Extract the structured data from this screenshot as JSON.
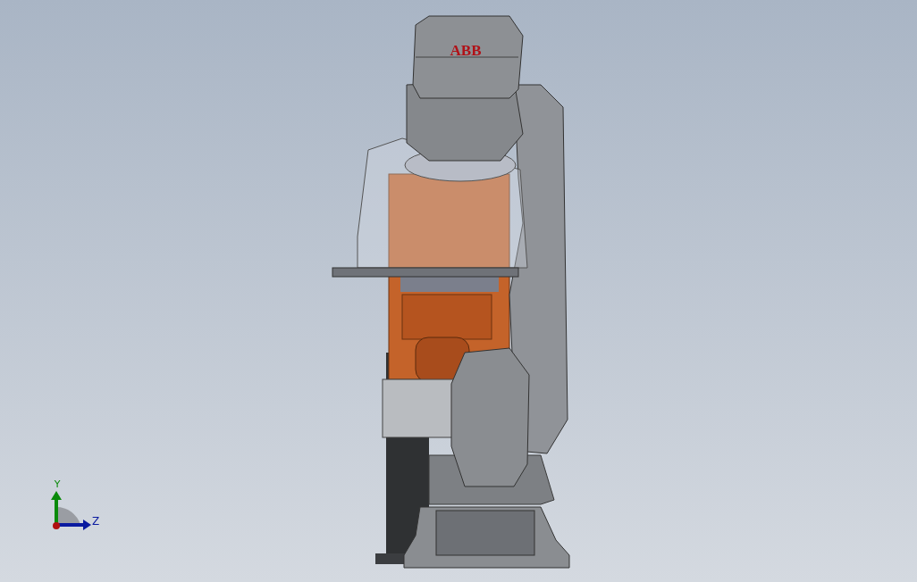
{
  "viewport": {
    "model_label": "ABB",
    "triad": {
      "y_label": "Y",
      "z_label": "Z"
    }
  }
}
